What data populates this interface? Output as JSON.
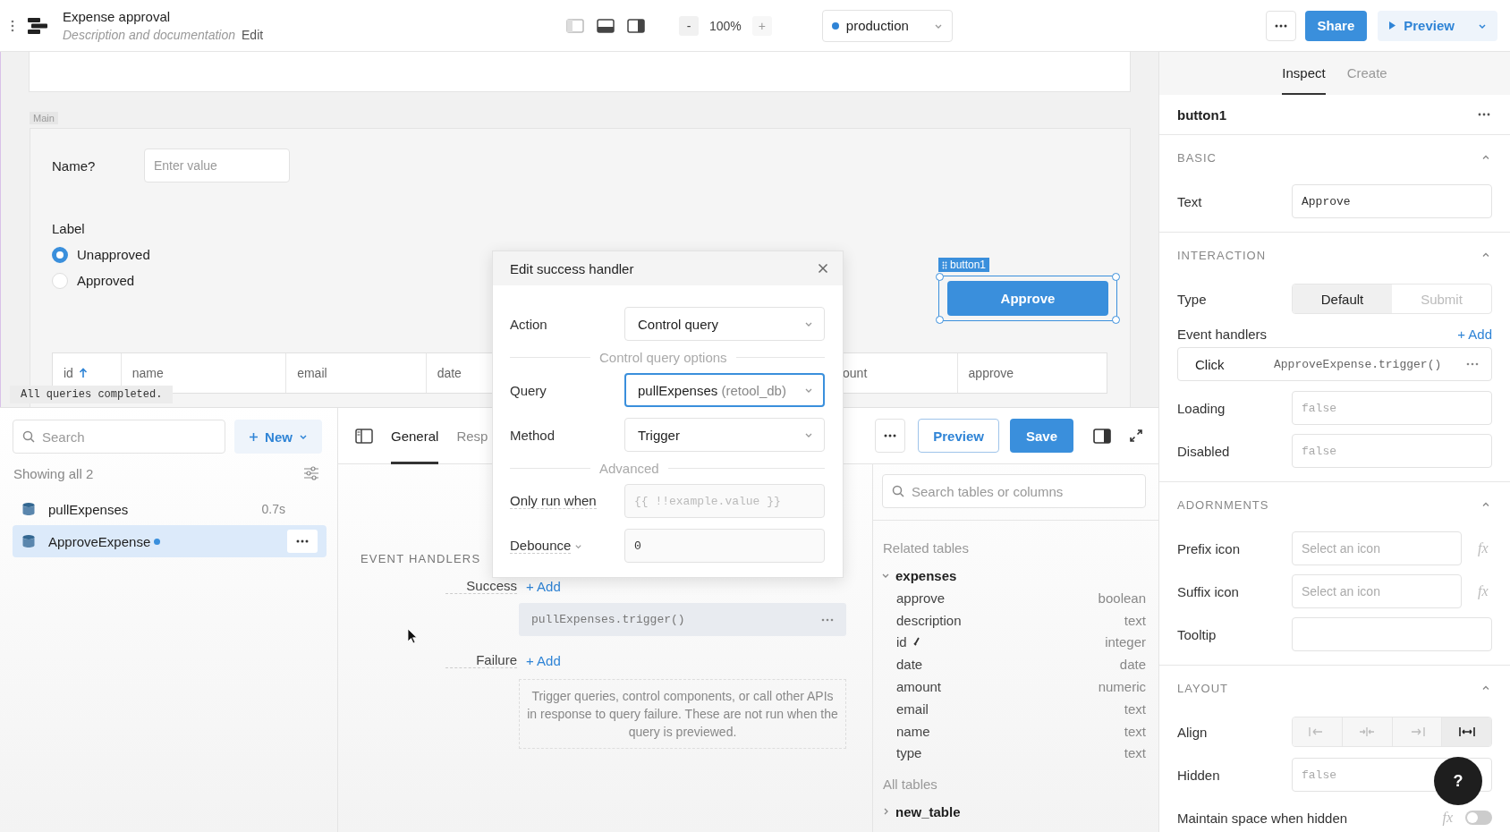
{
  "header": {
    "title": "Expense approval",
    "description": "Description and documentation",
    "edit_link": "Edit"
  },
  "layout_toggles": [
    {
      "on": false
    },
    {
      "on": true
    },
    {
      "on": true
    }
  ],
  "zoom": {
    "buttons": [
      {
        "label": "-",
        "disabled": false
      },
      {
        "label": "+",
        "disabled": true
      }
    ],
    "level": "100%"
  },
  "environment": {
    "label": "production"
  },
  "actions": {
    "share": "Share",
    "preview": "Preview"
  },
  "canvas": {
    "section_label": "Main",
    "name_field": {
      "label": "Name?",
      "placeholder": "Enter value"
    },
    "radio_group": {
      "label": "Label",
      "options": [
        {
          "label": "Unapproved",
          "selected": true
        },
        {
          "label": "Approved",
          "selected": false
        }
      ]
    },
    "table": {
      "columns": [
        {
          "label": "id",
          "sorted": true
        },
        {
          "label": "name",
          "sorted": false
        },
        {
          "label": "email",
          "sorted": false
        },
        {
          "label": "date",
          "sorted": false
        },
        {
          "label": "ount",
          "sorted": false
        },
        {
          "label": "approve",
          "sorted": false
        }
      ]
    },
    "button": {
      "tag": "button1",
      "text": "Approve"
    },
    "toast": "All queries completed."
  },
  "queries_panel": {
    "search_placeholder": "Search",
    "new_button": "New",
    "count_label": "Showing all 2",
    "items": [
      {
        "name": "pullExpenses",
        "time": "0.7s",
        "selected": false,
        "unsaved": false
      },
      {
        "name": "ApproveExpense",
        "selected": true,
        "unsaved": true
      }
    ]
  },
  "editor": {
    "tabs": [
      {
        "label": "General",
        "selected": true
      },
      {
        "label": "Resp",
        "selected": false
      }
    ],
    "preview_button": "Preview",
    "save_button": "Save",
    "event_handlers": {
      "heading": "EVENT HANDLERS",
      "groups": [
        {
          "label": "Success",
          "add": "+ Add",
          "handlers": [
            "pullExpenses.trigger()"
          ]
        },
        {
          "label": "Failure",
          "add": "+ Add",
          "empty_text": "Trigger queries, control components, or call other APIs in response to query failure. These are not run when the query is previewed."
        }
      ]
    }
  },
  "schema": {
    "search_placeholder": "Search tables or columns",
    "related_heading": "Related tables",
    "related_tables": [
      {
        "name": "expenses",
        "expanded": true,
        "children": [
          {
            "name": "approve",
            "type": "boolean",
            "primary_key": false
          },
          {
            "name": "description",
            "type": "text",
            "primary_key": false
          },
          {
            "name": "id",
            "type": "integer",
            "primary_key": true
          },
          {
            "name": "date",
            "type": "date",
            "primary_key": false
          },
          {
            "name": "amount",
            "type": "numeric",
            "primary_key": false
          },
          {
            "name": "email",
            "type": "text",
            "primary_key": false
          },
          {
            "name": "name",
            "type": "text",
            "primary_key": false
          },
          {
            "name": "type",
            "type": "text",
            "primary_key": false
          }
        ]
      }
    ],
    "all_heading": "All tables",
    "all_tables": [
      {
        "name": "new_table",
        "expanded": false
      }
    ]
  },
  "modal": {
    "title": "Edit success handler",
    "fields": [
      {
        "kind": "select",
        "label": "Action",
        "value": "Control query",
        "focused": false
      },
      {
        "kind": "divider",
        "label": "Control query options"
      },
      {
        "kind": "select",
        "label": "Query",
        "value": "pullExpenses",
        "hint": "(retool_db)",
        "focused": true
      },
      {
        "kind": "select",
        "label": "Method",
        "value": "Trigger",
        "focused": false
      },
      {
        "kind": "divider",
        "label": "Advanced"
      },
      {
        "kind": "input",
        "label": "Only run when",
        "placeholder": "{{ !!example.value }}",
        "label_caret": false
      },
      {
        "kind": "input",
        "label": "Debounce",
        "value": "0",
        "label_caret": true
      }
    ]
  },
  "inspector": {
    "tabs": [
      {
        "label": "Inspect",
        "selected": true
      },
      {
        "label": "Create",
        "selected": false
      }
    ],
    "component_name": "button1",
    "sections": [
      {
        "title": "BASIC",
        "expanded": true,
        "rows": [
          {
            "kind": "text",
            "label": "Text",
            "value": "Approve"
          }
        ]
      },
      {
        "title": "INTERACTION",
        "expanded": true,
        "rows": [
          {
            "kind": "segmented",
            "label": "Type",
            "options": [
              {
                "label": "Default",
                "selected": true
              },
              {
                "label": "Submit",
                "selected": false
              }
            ]
          },
          {
            "kind": "handlers",
            "label": "Event handlers",
            "add": "+ Add",
            "handlers": [
              {
                "event": "Click",
                "action": "ApproveExpense.trigger()"
              }
            ]
          },
          {
            "kind": "text",
            "label": "Loading",
            "placeholder": "false"
          },
          {
            "kind": "text",
            "label": "Disabled",
            "placeholder": "false"
          }
        ]
      },
      {
        "title": "ADORNMENTS",
        "expanded": true,
        "rows": [
          {
            "kind": "icon-select",
            "label": "Prefix icon",
            "placeholder": "Select an icon",
            "fx": "fx"
          },
          {
            "kind": "icon-select",
            "label": "Suffix icon",
            "placeholder": "Select an icon",
            "fx": "fx"
          },
          {
            "kind": "text",
            "label": "Tooltip"
          }
        ]
      },
      {
        "title": "LAYOUT",
        "expanded": true,
        "rows": [
          {
            "kind": "align",
            "label": "Align",
            "options": [
              {
                "kind": "left",
                "selected": false
              },
              {
                "kind": "center",
                "selected": false
              },
              {
                "kind": "right",
                "selected": false
              },
              {
                "kind": "stretch",
                "selected": true
              }
            ]
          },
          {
            "kind": "text",
            "label": "Hidden",
            "placeholder": "false"
          },
          {
            "kind": "toggle",
            "label": "Maintain space when hidden",
            "fx": "fx",
            "on": false
          }
        ]
      }
    ]
  },
  "help_button": "?"
}
